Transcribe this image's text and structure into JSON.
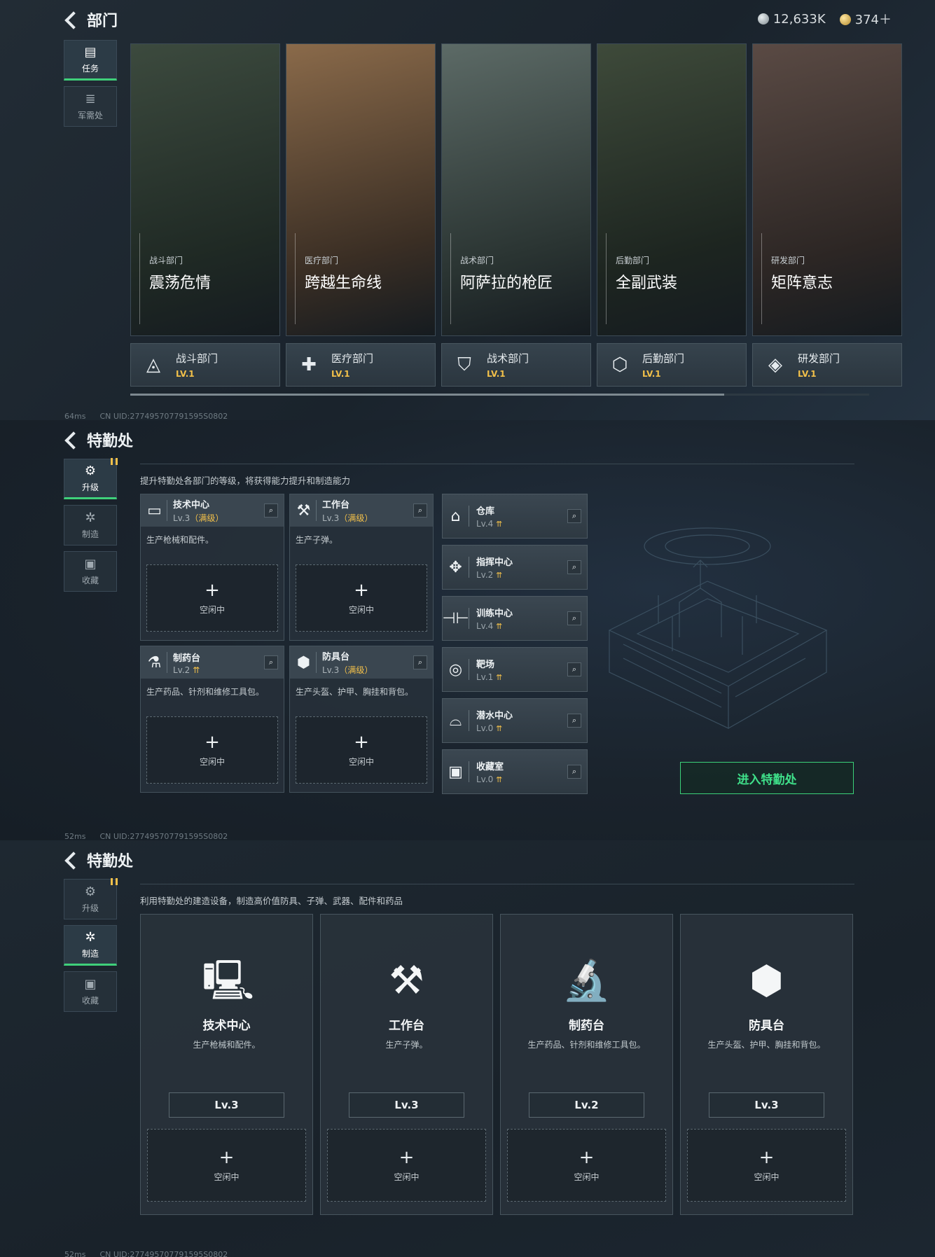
{
  "panel1": {
    "title": "部门",
    "currency": {
      "silver": "12,633K",
      "gold": "374＋"
    },
    "nav": [
      {
        "label": "任务",
        "icon": "task-icon"
      },
      {
        "label": "军需处",
        "icon": "supply-icon"
      }
    ],
    "cards": [
      {
        "sub": "战斗部门",
        "name": "震荡危情",
        "tile_name": "战斗部门",
        "tile_level": "LV.1",
        "colors": [
          "#3c4a3e",
          "#1f2924"
        ]
      },
      {
        "sub": "医疗部门",
        "name": "跨越生命线",
        "tile_name": "医疗部门",
        "tile_level": "LV.1",
        "colors": [
          "#8a6a4a",
          "#3a2e24"
        ]
      },
      {
        "sub": "战术部门",
        "name": "阿萨拉的枪匠",
        "tile_name": "战术部门",
        "tile_level": "LV.1",
        "colors": [
          "#5c6a66",
          "#2a3432"
        ]
      },
      {
        "sub": "后勤部门",
        "name": "全副武装",
        "tile_name": "后勤部门",
        "tile_level": "LV.1",
        "colors": [
          "#3e4a3a",
          "#1d2520"
        ]
      },
      {
        "sub": "研发部门",
        "name": "矩阵意志",
        "tile_name": "研发部门",
        "tile_level": "LV.1",
        "colors": [
          "#5a4a44",
          "#2c2624"
        ]
      }
    ],
    "status": {
      "ping": "64ms",
      "uid": "CN UID:277495707791595S0802"
    }
  },
  "panel2": {
    "title": "特勤处",
    "nav": [
      {
        "label": "升级",
        "icon": "upgrade-icon"
      },
      {
        "label": "制造",
        "icon": "craft-icon"
      },
      {
        "label": "收藏",
        "icon": "collection-icon"
      }
    ],
    "desc": "提升特勤处各部门的等级，将获得能力提升和制造能力",
    "sections": [
      {
        "name": "技术中心",
        "level": "Lv.3",
        "max": "（满级）",
        "desc": "生产枪械和配件。",
        "icon": "▭"
      },
      {
        "name": "工作台",
        "level": "Lv.3",
        "max": "（满级）",
        "desc": "生产子弹。",
        "icon": "⚒"
      },
      {
        "name": "制药台",
        "level": "Lv.2",
        "max": "",
        "desc": "生产药品、针剂和维修工具包。",
        "icon": "⚗"
      },
      {
        "name": "防具台",
        "level": "Lv.3",
        "max": "（满级）",
        "desc": "生产头盔、护甲、胸挂和背包。",
        "icon": "⬢"
      }
    ],
    "slot": {
      "plus": "+",
      "idle": "空闲中"
    },
    "facilities": [
      {
        "name": "仓库",
        "level": "Lv.4",
        "icon": "⌂"
      },
      {
        "name": "指挥中心",
        "level": "Lv.2",
        "icon": "✥"
      },
      {
        "name": "训练中心",
        "level": "Lv.4",
        "icon": "⊣⊢"
      },
      {
        "name": "靶场",
        "level": "Lv.1",
        "icon": "◎"
      },
      {
        "name": "潜水中心",
        "level": "Lv.0",
        "icon": "⌓"
      },
      {
        "name": "收藏室",
        "level": "Lv.0",
        "icon": "▣"
      }
    ],
    "enter": "进入特勤处",
    "status": {
      "ping": "52ms",
      "uid": "CN UID:277495707791595S0802"
    }
  },
  "panel3": {
    "title": "特勤处",
    "nav": [
      {
        "label": "升级",
        "icon": "upgrade-icon"
      },
      {
        "label": "制造",
        "icon": "craft-icon"
      },
      {
        "label": "收藏",
        "icon": "collection-icon"
      }
    ],
    "desc": "利用特勤处的建造设备，制造高价值防具、子弹、武器、配件和药品",
    "stations": [
      {
        "name": "技术中心",
        "desc": "生产枪械和配件。",
        "level": "Lv.3",
        "icon": "🖳"
      },
      {
        "name": "工作台",
        "desc": "生产子弹。",
        "level": "Lv.3",
        "icon": "⚒"
      },
      {
        "name": "制药台",
        "desc": "生产药品、针剂和维修工具包。",
        "level": "Lv.2",
        "icon": "🔬"
      },
      {
        "name": "防具台",
        "desc": "生产头盔、护甲、胸挂和背包。",
        "level": "Lv.3",
        "icon": "⬢"
      }
    ],
    "status": {
      "ping": "52ms",
      "uid": "CN UID:277495707791595S0802"
    }
  },
  "colors": {
    "accent": "#3fd07a",
    "gold": "#f2c04a"
  }
}
